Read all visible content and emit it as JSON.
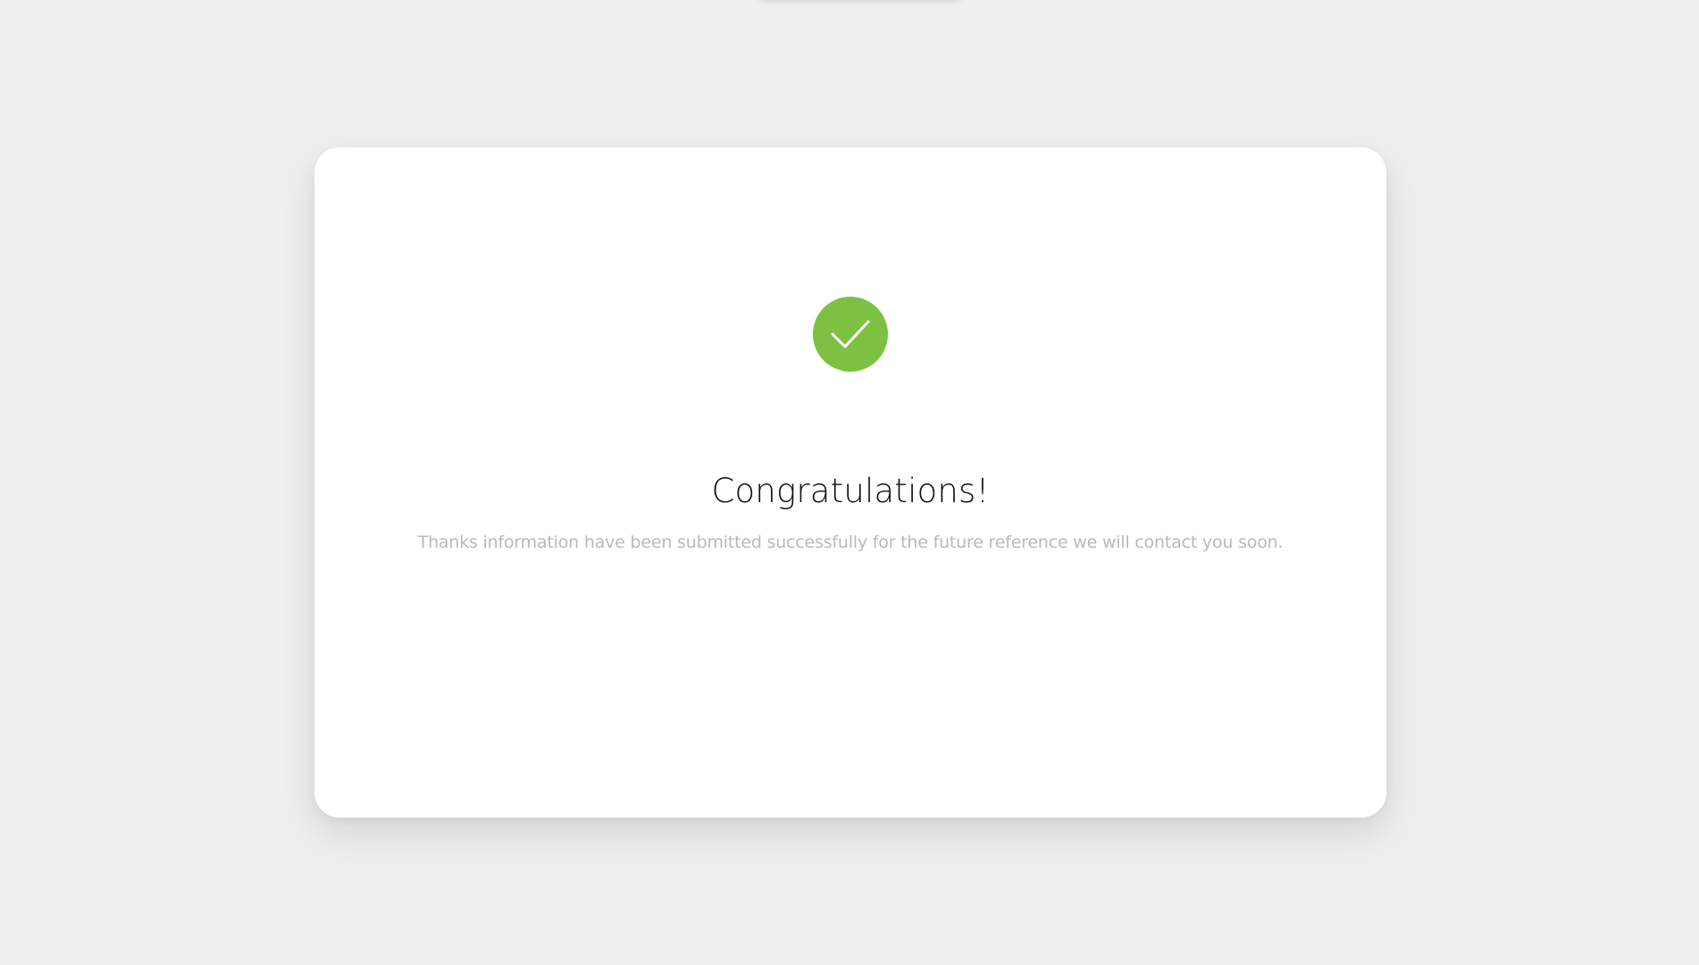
{
  "colors": {
    "background": "#eeeeee",
    "card": "#ffffff",
    "success": "#7cc142",
    "title": "#111111",
    "message": "#b9b9bd"
  },
  "icon": "check-icon",
  "success_card": {
    "title": "Congratulations!",
    "message": "Thanks information have been submitted successfully for the future reference we will contact you soon."
  }
}
